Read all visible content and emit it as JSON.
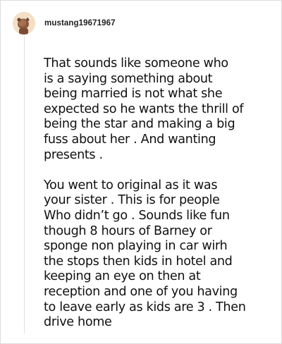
{
  "comment": {
    "username": "mustang19671967",
    "avatar_icon": "user-avatar-icon",
    "paragraphs": [
      "That sounds like someone who\nis a saying something about\nbeing married is not what she\nexpected so he wants the thrill of\nbeing the star and making a big\nfuss about her . And wanting\npresents .",
      "You went to original as it was\nyour sister . This is for people\nWho didn’t go . Sounds like fun\nthough 8 hours of Barney or\nsponge non playing in car wirh\nthe stops then kids in hotel and\nkeeping an eye on then at\nreception and one of you having\nto leave early as kids are 3 . Then\ndrive home"
    ]
  }
}
